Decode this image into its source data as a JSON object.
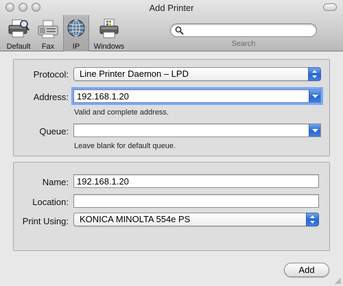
{
  "window": {
    "title": "Add Printer"
  },
  "toolbar": {
    "buttons": [
      {
        "label": "Default",
        "icon": "printer-magnifier-icon",
        "selected": false
      },
      {
        "label": "Fax",
        "icon": "fax-icon",
        "selected": false
      },
      {
        "label": "IP",
        "icon": "globe-icon",
        "selected": true
      },
      {
        "label": "Windows",
        "icon": "windows-printer-icon",
        "selected": false
      }
    ],
    "search": {
      "value": "",
      "placeholder": "",
      "label": "Search"
    }
  },
  "connection": {
    "protocol_label": "Protocol:",
    "protocol_value": "Line Printer Daemon – LPD",
    "address_label": "Address:",
    "address_value": "192.168.1.20",
    "address_hint": "Valid and complete address.",
    "queue_label": "Queue:",
    "queue_value": "",
    "queue_hint": "Leave blank for default queue."
  },
  "printer": {
    "name_label": "Name:",
    "name_value": "192.168.1.20",
    "location_label": "Location:",
    "location_value": "",
    "print_using_label": "Print Using:",
    "print_using_value": "KONICA MINOLTA 554e PS"
  },
  "footer": {
    "add_label": "Add"
  },
  "colors": {
    "accent": "#3a77d8",
    "focus_ring": "#7eaaf0"
  }
}
